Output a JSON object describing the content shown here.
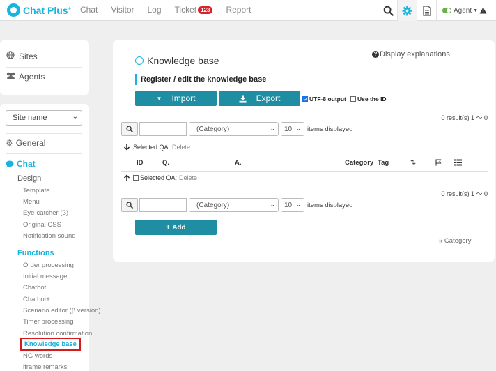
{
  "topbar": {
    "logo": "Chat Plus",
    "logo_sup": "+",
    "nav": [
      "Chat",
      "Visitor",
      "Log",
      "Ticket",
      "Report"
    ],
    "ticket_badge": "123",
    "agent_label": "Agent",
    "icons": [
      "search-icon",
      "gear-icon",
      "document-icon",
      "warning-icon"
    ],
    "accent_color": "#1ab3dd"
  },
  "sidebar": {
    "top_items": [
      {
        "label": "Sites",
        "icon": "globe-icon"
      },
      {
        "label": "Agents",
        "icon": "users-icon"
      }
    ],
    "site_select": "Site name",
    "general": "General",
    "chat": "Chat",
    "design": "Design",
    "design_items": [
      "Template",
      "Menu",
      "Eye-catcher (β)",
      "Original CSS",
      "Notification sound"
    ],
    "functions": "Functions",
    "function_items": [
      "Order processing",
      "Initial message",
      "Chatbot",
      "Chatbot+",
      "Scenario editor (β version)",
      "Timer processing",
      "Resolution confirmation"
    ],
    "selected_item": "Knowledge base",
    "after_items": [
      "NG words",
      "iframe remarks"
    ]
  },
  "main": {
    "title": "Knowledge base",
    "explain_link": "Display explanations",
    "section_title": "Register / edit the knowledge base",
    "import_label": "Import",
    "export_label": "Export",
    "utf8_label": "UTF-8 output",
    "use_id_label": "Use the ID",
    "result_text": "0 result(s) 1 ～ 0",
    "category_placeholder": "(Category)",
    "per_page": "10",
    "items_displayed": "items displayed",
    "selected_qa_label": "Selected QA:",
    "delete_label": "Delete",
    "columns": [
      "ID",
      "Q.",
      "A.",
      "Category",
      "Tag"
    ],
    "add_label": "Add",
    "category_link": "» Category"
  }
}
